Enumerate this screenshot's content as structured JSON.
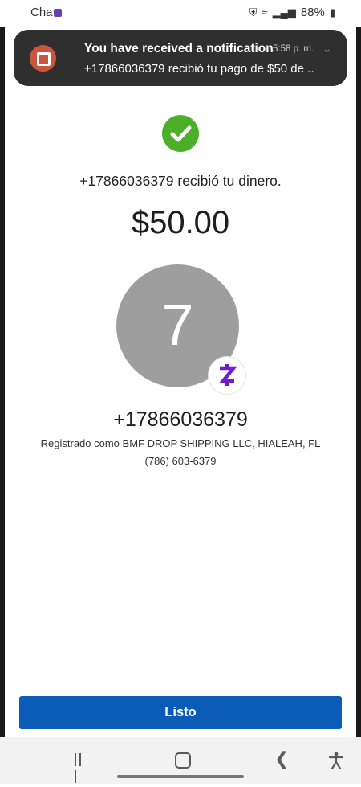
{
  "status_bar": {
    "app_label": "Cha",
    "battery": "88%"
  },
  "notification": {
    "title": "You have received a notification",
    "time": "5:58 p. m.",
    "body": "+17866036379 recibió tu pago de $50 de .."
  },
  "payment": {
    "message": "+17866036379 recibió tu dinero.",
    "amount": "$50.00"
  },
  "recipient": {
    "avatar_initial": "7",
    "phone": "+17866036379",
    "registered": "Registrado como BMF DROP SHIPPING LLC, HIALEAH, FL",
    "phone_secondary": "(786) 603-6379"
  },
  "actions": {
    "done_label": "Listo"
  },
  "colors": {
    "accent": "#0a5cb8",
    "success": "#4caf2a",
    "zelle": "#6d1ed4"
  }
}
